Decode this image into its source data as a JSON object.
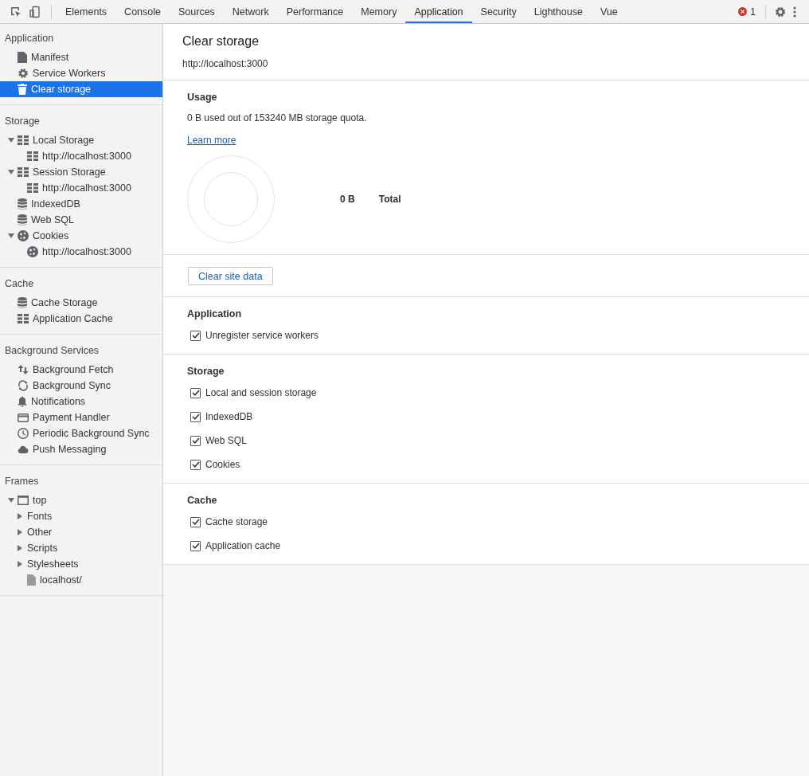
{
  "toolbar": {
    "tabs": [
      {
        "label": "Elements",
        "selected": false
      },
      {
        "label": "Console",
        "selected": false
      },
      {
        "label": "Sources",
        "selected": false
      },
      {
        "label": "Network",
        "selected": false
      },
      {
        "label": "Performance",
        "selected": false
      },
      {
        "label": "Memory",
        "selected": false
      },
      {
        "label": "Application",
        "selected": true
      },
      {
        "label": "Security",
        "selected": false
      },
      {
        "label": "Lighthouse",
        "selected": false
      },
      {
        "label": "Vue",
        "selected": false
      }
    ],
    "error_count": "1"
  },
  "sidebar": {
    "sections": [
      {
        "title": "Application",
        "items": [
          {
            "label": "Manifest",
            "kind": "document",
            "selected": false
          },
          {
            "label": "Service Workers",
            "kind": "gear",
            "selected": false
          },
          {
            "label": "Clear storage",
            "kind": "trash",
            "selected": true
          }
        ]
      },
      {
        "title": "Storage",
        "items": [
          {
            "label": "Local Storage",
            "kind": "table",
            "selected": false,
            "expanded": true,
            "children": [
              {
                "label": "http://localhost:3000",
                "kind": "table",
                "selected": false
              }
            ]
          },
          {
            "label": "Session Storage",
            "kind": "table",
            "selected": false,
            "expanded": true,
            "children": [
              {
                "label": "http://localhost:3000",
                "kind": "table",
                "selected": false
              }
            ]
          },
          {
            "label": "IndexedDB",
            "kind": "database",
            "selected": false
          },
          {
            "label": "Web SQL",
            "kind": "database",
            "selected": false
          },
          {
            "label": "Cookies",
            "kind": "cookie",
            "selected": false,
            "expanded": true,
            "children": [
              {
                "label": "http://localhost:3000",
                "kind": "cookie",
                "selected": false
              }
            ]
          }
        ]
      },
      {
        "title": "Cache",
        "items": [
          {
            "label": "Cache Storage",
            "kind": "database",
            "selected": false
          },
          {
            "label": "Application Cache",
            "kind": "table",
            "selected": false
          }
        ]
      },
      {
        "title": "Background Services",
        "items": [
          {
            "label": "Background Fetch",
            "kind": "arrows",
            "selected": false
          },
          {
            "label": "Background Sync",
            "kind": "sync",
            "selected": false
          },
          {
            "label": "Notifications",
            "kind": "bell",
            "selected": false
          },
          {
            "label": "Payment Handler",
            "kind": "card",
            "selected": false
          },
          {
            "label": "Periodic Background Sync",
            "kind": "clock",
            "selected": false
          },
          {
            "label": "Push Messaging",
            "kind": "cloud",
            "selected": false
          }
        ]
      },
      {
        "title": "Frames",
        "items": [
          {
            "label": "top",
            "kind": "frame",
            "selected": false,
            "expanded": true,
            "children": [
              {
                "label": "Fonts",
                "kind": "folder",
                "selected": false,
                "expanded": false
              },
              {
                "label": "Other",
                "kind": "folder",
                "selected": false,
                "expanded": false
              },
              {
                "label": "Scripts",
                "kind": "folder",
                "selected": false,
                "expanded": false
              },
              {
                "label": "Stylesheets",
                "kind": "folder",
                "selected": false,
                "expanded": false
              },
              {
                "label": "localhost/",
                "kind": "file",
                "selected": false
              }
            ]
          }
        ]
      }
    ]
  },
  "main": {
    "title": "Clear storage",
    "url": "http://localhost:3000",
    "usage": {
      "heading": "Usage",
      "text": "0 B used out of 153240 MB storage quota.",
      "link": "Learn more",
      "total_value": "0 B",
      "total_label": "Total"
    },
    "button": "Clear site data",
    "groups": [
      {
        "heading": "Application",
        "options": [
          {
            "label": "Unregister service workers",
            "checked": true
          }
        ]
      },
      {
        "heading": "Storage",
        "options": [
          {
            "label": "Local and session storage",
            "checked": true
          },
          {
            "label": "IndexedDB",
            "checked": true
          },
          {
            "label": "Web SQL",
            "checked": true
          },
          {
            "label": "Cookies",
            "checked": true
          }
        ]
      },
      {
        "heading": "Cache",
        "options": [
          {
            "label": "Cache storage",
            "checked": true
          },
          {
            "label": "Application cache",
            "checked": true
          }
        ]
      }
    ]
  }
}
